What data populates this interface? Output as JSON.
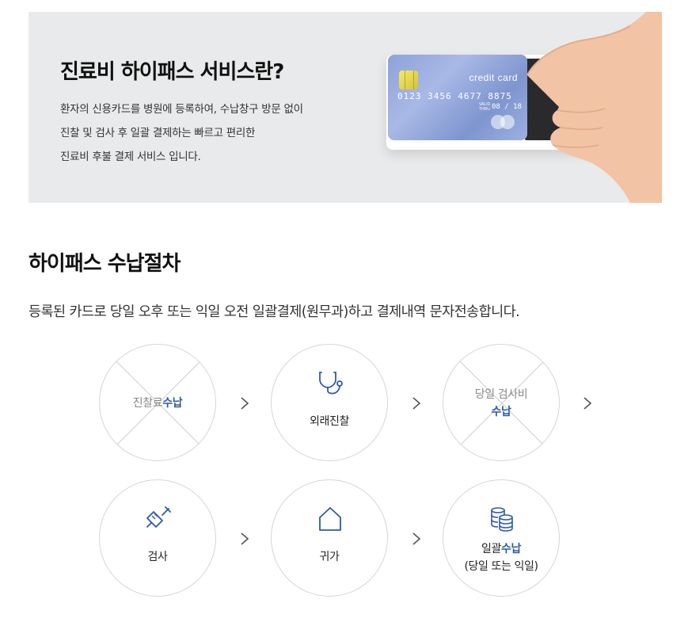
{
  "hero": {
    "title": "진료비 하이패스 서비스란?",
    "desc_lines": [
      "환자의 신용카드를 병원에 등록하여, 수납창구 방문 없이",
      "진찰 및 검사 후 일괄 결제하는 빠르고 편리한",
      "진료비 후불 결제 서비스 입니다."
    ],
    "card": {
      "brand": "credit card",
      "number": "0123  3456  4677  8875",
      "valid_thru_line1": "VALID",
      "valid_thru_line2": "THRU",
      "expiry": "08 / 18",
      "color": "#8ea2d8"
    }
  },
  "section": {
    "title": "하이패스 수납절차",
    "desc": "등록된 카드로 당일 오후 또는 익일 오전 일괄결제(원무과)하고 결제내역 문자전송합니다."
  },
  "accent_color": "#2e5aa8",
  "steps": [
    {
      "crossed": true,
      "text_a": "진찰료",
      "text_b": "수납",
      "icon": ""
    },
    {
      "crossed": false,
      "text_a": "외래진찰",
      "icon": "stethoscope-icon"
    },
    {
      "crossed": true,
      "text_a": "당일 검사비",
      "text_b": "수납",
      "icon": ""
    },
    {
      "crossed": false,
      "text_a": "검사",
      "icon": "syringe-icon"
    },
    {
      "crossed": false,
      "text_a": "귀가",
      "icon": "home-icon"
    },
    {
      "crossed": false,
      "text_a": "일괄",
      "text_b": "수납",
      "text_c": "(당일 또는 익일)",
      "icon": "coins-icon"
    }
  ]
}
